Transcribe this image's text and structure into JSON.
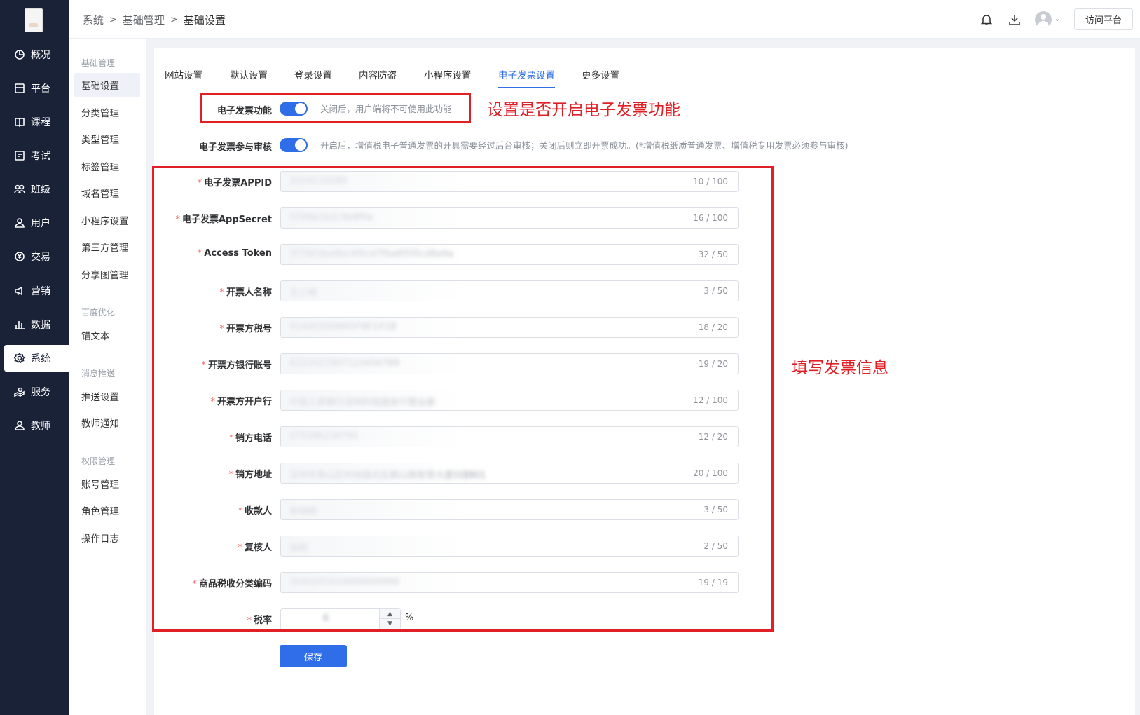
{
  "nav": {
    "items": [
      {
        "label": "概况",
        "icon": "dashboard-icon"
      },
      {
        "label": "平台",
        "icon": "platform-icon"
      },
      {
        "label": "课程",
        "icon": "book-icon"
      },
      {
        "label": "考试",
        "icon": "exam-icon"
      },
      {
        "label": "班级",
        "icon": "class-icon"
      },
      {
        "label": "用户",
        "icon": "user-icon"
      },
      {
        "label": "交易",
        "icon": "transaction-icon"
      },
      {
        "label": "营销",
        "icon": "megaphone-icon"
      },
      {
        "label": "数据",
        "icon": "bar-chart-icon"
      },
      {
        "label": "系统",
        "icon": "gear-icon"
      },
      {
        "label": "服务",
        "icon": "service-icon"
      },
      {
        "label": "教师",
        "icon": "teacher-icon"
      }
    ]
  },
  "subnav": {
    "groups": [
      {
        "title": "基础管理",
        "items": [
          "基础设置",
          "分类管理",
          "类型管理",
          "标签管理",
          "域名管理",
          "小程序设置",
          "第三方管理",
          "分享图管理"
        ]
      },
      {
        "title": "百度优化",
        "items": [
          "锚文本"
        ]
      },
      {
        "title": "消息推送",
        "items": [
          "推送设置",
          "教师通知"
        ]
      },
      {
        "title": "权限管理",
        "items": [
          "账号管理",
          "角色管理",
          "操作日志"
        ]
      }
    ]
  },
  "header": {
    "breadcrumb": [
      "系统",
      "基础管理",
      "基础设置"
    ],
    "visit_label": "访问平台"
  },
  "tabs": [
    "网站设置",
    "默认设置",
    "登录设置",
    "内容防盗",
    "小程序设置",
    "电子发票设置",
    "更多设置"
  ],
  "switches": [
    {
      "label": "电子发票功能",
      "hint": "关闭后，用户端将不可使用此功能"
    },
    {
      "label": "电子发票参与审核",
      "hint": "开启后，增值税电子普通发票的开具需要经过后台审核；关闭后则立即开票成功。(*增值税纸质普通发票、增值税专用发票必须参与审核)"
    }
  ],
  "fields": [
    {
      "label": "电子发票APPID",
      "value": "2024110285",
      "count": "10 / 100"
    },
    {
      "label": "电子发票AppSecret",
      "value": "5f3f6b1b2c9a9f0a",
      "count": "16 / 100"
    },
    {
      "label": "Access Token",
      "value": "3f7f6f3ba9bc4f0cd7f6a8f5f0cd8a9a",
      "count": "32 / 50"
    },
    {
      "label": "开票人名称",
      "value": "王小明",
      "count": "3 / 50"
    },
    {
      "label": "开票方税号",
      "value": "91440300MA5F8E1X1B",
      "count": "18 / 20"
    },
    {
      "label": "开票方银行账号",
      "value": "6222021907123456789",
      "count": "19 / 20"
    },
    {
      "label": "开票方开户行",
      "value": "中国工商银行深圳科技园支行营业部",
      "count": "12 / 100"
    },
    {
      "label": "销方电话",
      "value": "075586230791",
      "count": "12 / 20"
    },
    {
      "label": "销方地址",
      "value": "深圳市南山区科技园北区朗山路智慧大厦8层801",
      "count": "20 / 100"
    },
    {
      "label": "收款人",
      "value": "李明明",
      "count": "3 / 50"
    },
    {
      "label": "复核人",
      "value": "张明",
      "count": "2 / 50"
    },
    {
      "label": "商品税收分类编码",
      "value": "3040201010000000000",
      "count": "19 / 19"
    }
  ],
  "tax": {
    "label": "税率",
    "value": "6",
    "unit": "%"
  },
  "save_label": "保存",
  "annotations": {
    "switch_note": "设置是否开启电子发票功能",
    "fields_note": "填写发票信息"
  },
  "colors": {
    "accent": "#2f6ee8",
    "sidebar": "#1a2238",
    "annotation": "#e02027"
  }
}
